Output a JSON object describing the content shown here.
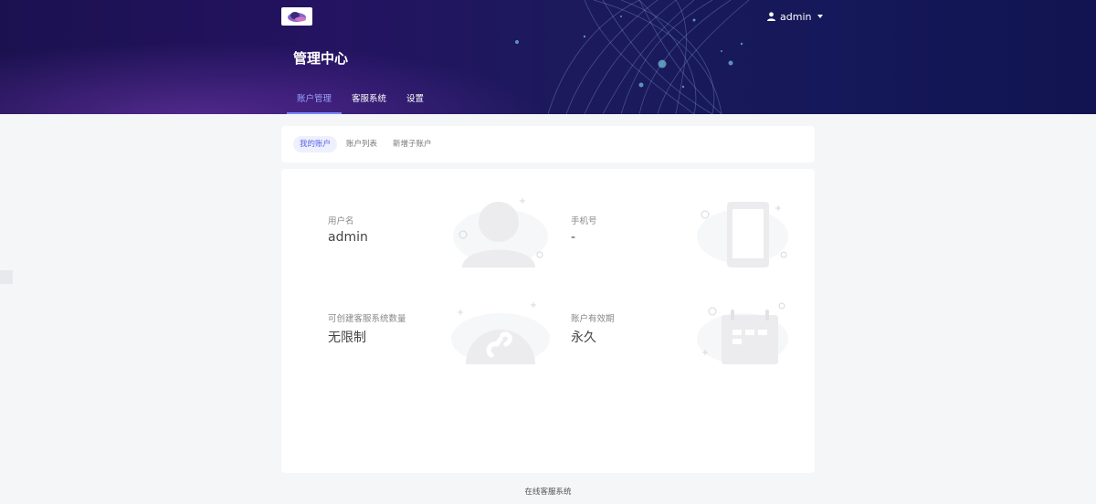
{
  "header": {
    "page_title": "管理中心",
    "username": "admin",
    "nav": [
      {
        "label": "账户管理",
        "active": true
      },
      {
        "label": "客服系统",
        "active": false
      },
      {
        "label": "设置",
        "active": false
      }
    ]
  },
  "subtabs": [
    {
      "label": "我的账户",
      "active": true
    },
    {
      "label": "账户列表",
      "active": false
    },
    {
      "label": "新增子账户",
      "active": false
    }
  ],
  "account": {
    "username": {
      "label": "用户名",
      "value": "admin",
      "icon": "user-icon"
    },
    "phone": {
      "label": "手机号",
      "value": "-",
      "icon": "phone-icon"
    },
    "quota": {
      "label": "可创建客服系统数量",
      "value": "无限制",
      "icon": "link-icon"
    },
    "validity": {
      "label": "账户有效期",
      "value": "永久",
      "icon": "calendar-icon"
    }
  },
  "footer": {
    "text": "在线客服系统"
  },
  "colors": {
    "accent": "#7c86ff",
    "header_bg": "#1b1150"
  }
}
